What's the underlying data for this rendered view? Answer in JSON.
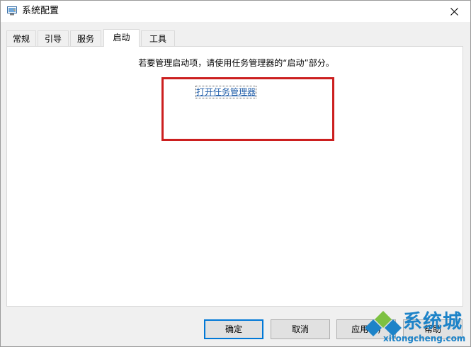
{
  "window": {
    "title": "系统配置",
    "close_glyph": "✕"
  },
  "tabs": [
    {
      "label": "常规",
      "active": false
    },
    {
      "label": "引导",
      "active": false
    },
    {
      "label": "服务",
      "active": false
    },
    {
      "label": "启动",
      "active": true
    },
    {
      "label": "工具",
      "active": false
    }
  ],
  "startup": {
    "instruction": "若要管理启动项，请使用任务管理器的“启动”部分。",
    "link_label": "打开任务管理器"
  },
  "buttons": {
    "ok": "确定",
    "cancel": "取消",
    "apply": "应用(A)",
    "help": "帮助"
  },
  "watermark": {
    "brand": "系统城",
    "site": "xitongcheng.com"
  },
  "colors": {
    "link": "#1f5ca8",
    "highlight": "#cc1f1f",
    "watermark": "#1d83c8",
    "default_button_border": "#0078d7"
  }
}
